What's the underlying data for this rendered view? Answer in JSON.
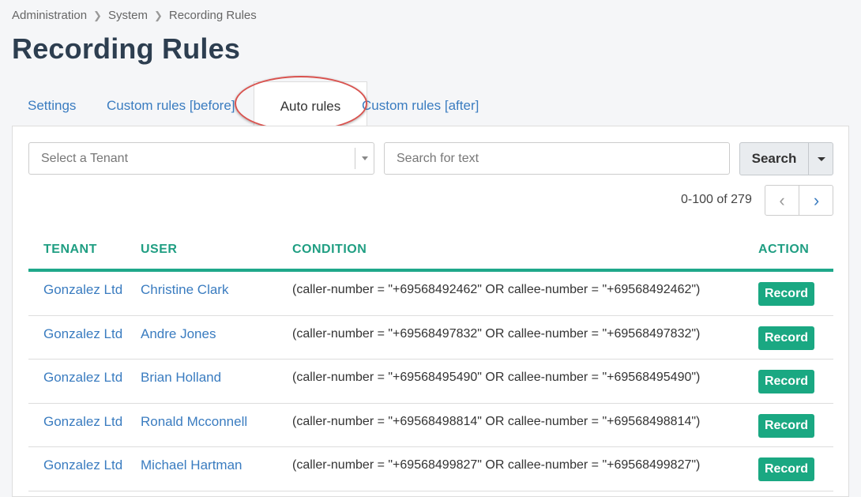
{
  "breadcrumb": [
    "Administration",
    "System",
    "Recording Rules"
  ],
  "page_title": "Recording Rules",
  "tabs": [
    {
      "label": "Settings"
    },
    {
      "label": "Custom rules [before]"
    },
    {
      "label": "Auto rules"
    },
    {
      "label": "Custom rules [after]"
    }
  ],
  "active_tab": "Auto rules",
  "filters": {
    "tenant_placeholder": "Select a Tenant",
    "search_placeholder": "Search for text",
    "search_label": "Search"
  },
  "pagination": {
    "text": "0-100 of 279",
    "prev": "‹",
    "next": "›"
  },
  "table": {
    "headers": {
      "tenant": "TENANT",
      "user": "USER",
      "condition": "CONDITION",
      "action": "ACTION"
    },
    "rows": [
      {
        "tenant": "Gonzalez Ltd",
        "user": "Christine Clark",
        "condition": "(caller-number = \"+69568492462\" OR callee-number = \"+69568492462\")",
        "action": "Record"
      },
      {
        "tenant": "Gonzalez Ltd",
        "user": "Andre Jones",
        "condition": "(caller-number = \"+69568497832\" OR callee-number = \"+69568497832\")",
        "action": "Record"
      },
      {
        "tenant": "Gonzalez Ltd",
        "user": "Brian Holland",
        "condition": "(caller-number = \"+69568495490\" OR callee-number = \"+69568495490\")",
        "action": "Record"
      },
      {
        "tenant": "Gonzalez Ltd",
        "user": "Ronald Mcconnell",
        "condition": "(caller-number = \"+69568498814\" OR callee-number = \"+69568498814\")",
        "action": "Record"
      },
      {
        "tenant": "Gonzalez Ltd",
        "user": "Michael Hartman",
        "condition": "(caller-number = \"+69568499827\" OR callee-number = \"+69568499827\")",
        "action": "Record"
      }
    ]
  },
  "colors": {
    "accent": "#1fa88a",
    "link": "#3a7cc0",
    "title": "#2d3e50",
    "annotation": "#d9534f"
  }
}
